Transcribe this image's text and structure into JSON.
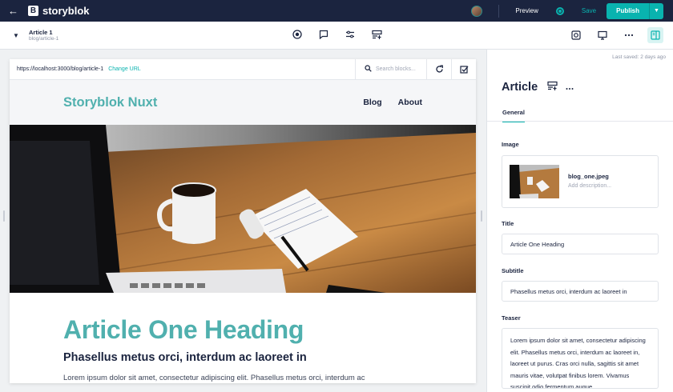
{
  "topbar": {
    "brand": "storyblok",
    "logo_letter": "B",
    "preview_label": "Preview",
    "save_label": "Save",
    "publish_label": "Publish"
  },
  "story": {
    "name": "Article 1",
    "slug": "blog/article-1"
  },
  "urlbar": {
    "url": "https://localhost:3000/blog/article-1",
    "change_url": "Change URL",
    "search_placeholder": "Search blocks..."
  },
  "site": {
    "brand": "Storyblok Nuxt",
    "nav": [
      "Blog",
      "About"
    ],
    "heading": "Article One Heading",
    "subheading": "Phasellus metus orci, interdum ac laoreet in",
    "paragraph": "Lorem ipsum dolor sit amet, consectetur adipiscing elit. Phasellus metus orci, interdum ac"
  },
  "panel": {
    "last_saved": "Last saved: 2 days ago",
    "title": "Article",
    "tab": "General",
    "image_label": "Image",
    "image_name": "blog_one.jpeg",
    "image_desc_placeholder": "Add description...",
    "title_label": "Title",
    "title_value": "Article One Heading",
    "subtitle_label": "Subtitle",
    "subtitle_value": "Phasellus metus orci, interdum ac laoreet in",
    "teaser_label": "Teaser",
    "teaser_value": "Lorem ipsum dolor sit amet, consectetur adipiscing elit. Phasellus metus orci, interdum ac laoreet in, laoreet ut purus. Cras orci nulla, sagittis sit amet mauris vitae, volutpat finibus lorem. Vivamus suscipit odio fermentum augue"
  },
  "colors": {
    "brand_dark": "#1b243f",
    "accent": "#09b3af",
    "site_teal": "#50b0ae"
  }
}
